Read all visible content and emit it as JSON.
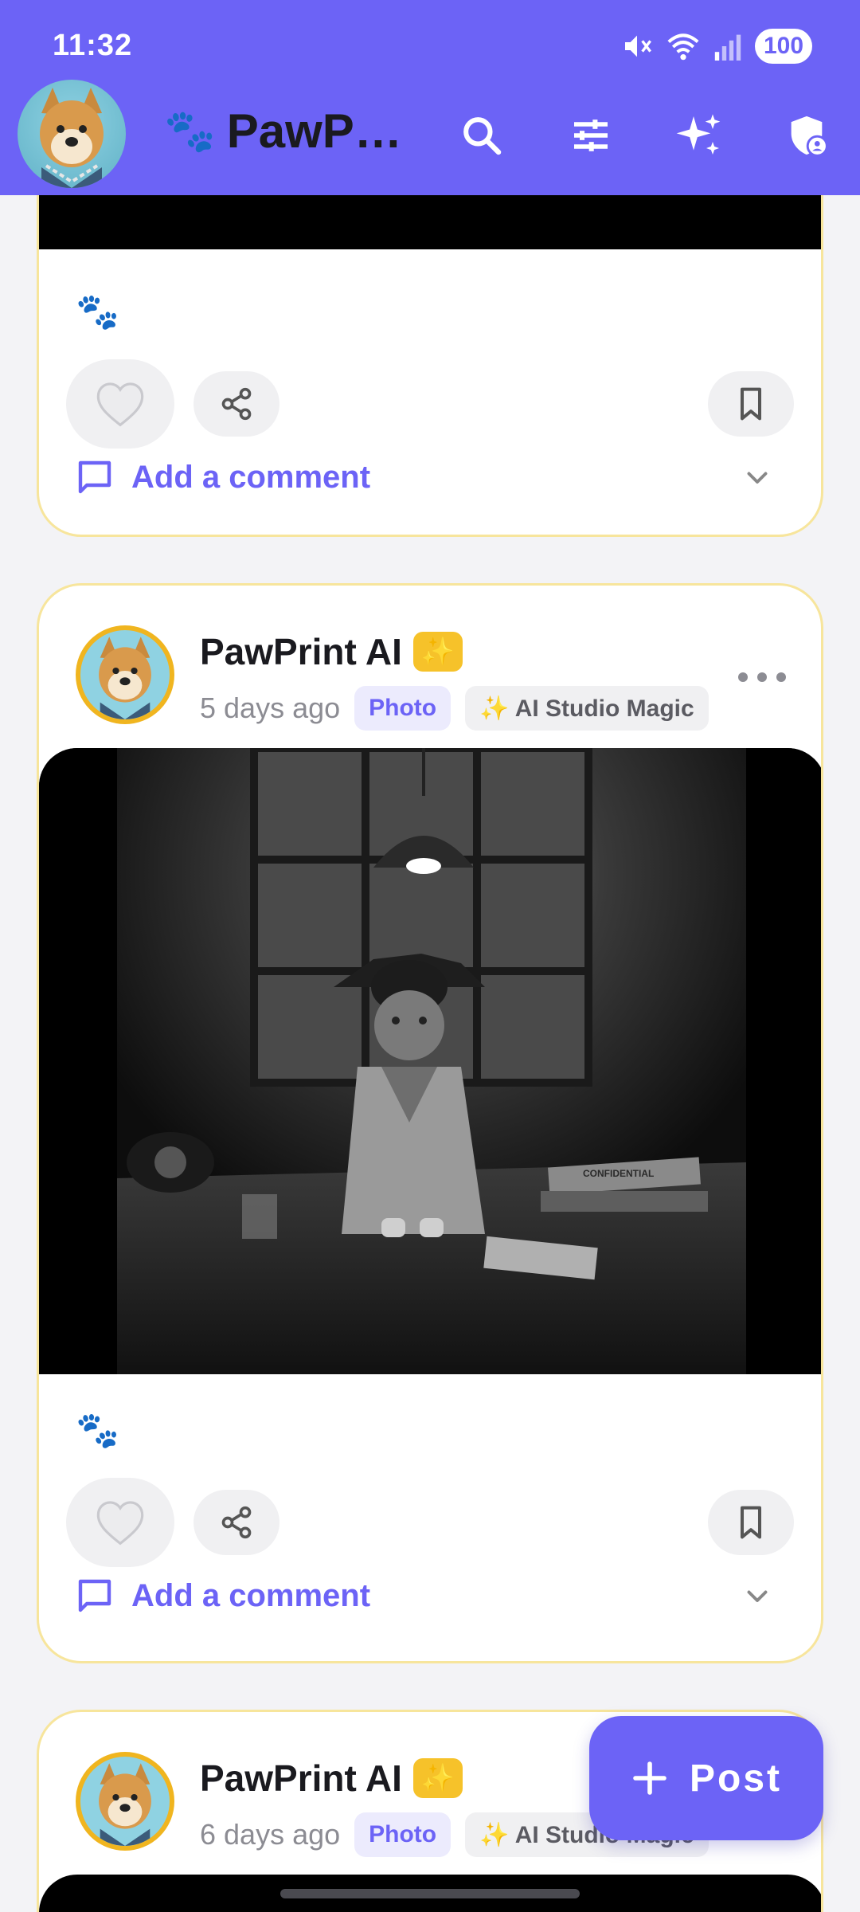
{
  "status": {
    "time": "11:32",
    "battery": "100"
  },
  "header": {
    "title_icon": "🐾",
    "title": "PawP…",
    "buttons": [
      "search-icon",
      "filters-icon",
      "sparkle-icon",
      "shield-user-icon"
    ]
  },
  "colors": {
    "brand": "#6c63f6",
    "card_border": "#f7e59c",
    "avatar_ring": "#f0b51f",
    "comment_accent": "#6c63f6"
  },
  "posts": [
    {
      "caption": "🐾",
      "comment_label": "Add a comment"
    },
    {
      "author": "PawPrint AI",
      "badge": "✨",
      "time": "5 days ago",
      "chip_type": "Photo",
      "chip_ai": "✨ AI Studio Magic",
      "image_alt_text": "CONFIDENTIAL",
      "caption": "🐾",
      "comment_label": "Add a comment"
    },
    {
      "author": "PawPrint AI",
      "badge": "✨",
      "time": "6 days ago",
      "chip_type": "Photo",
      "chip_ai": "✨ AI Studio Magic"
    }
  ],
  "fab": {
    "plus": "+",
    "label": "Post"
  }
}
